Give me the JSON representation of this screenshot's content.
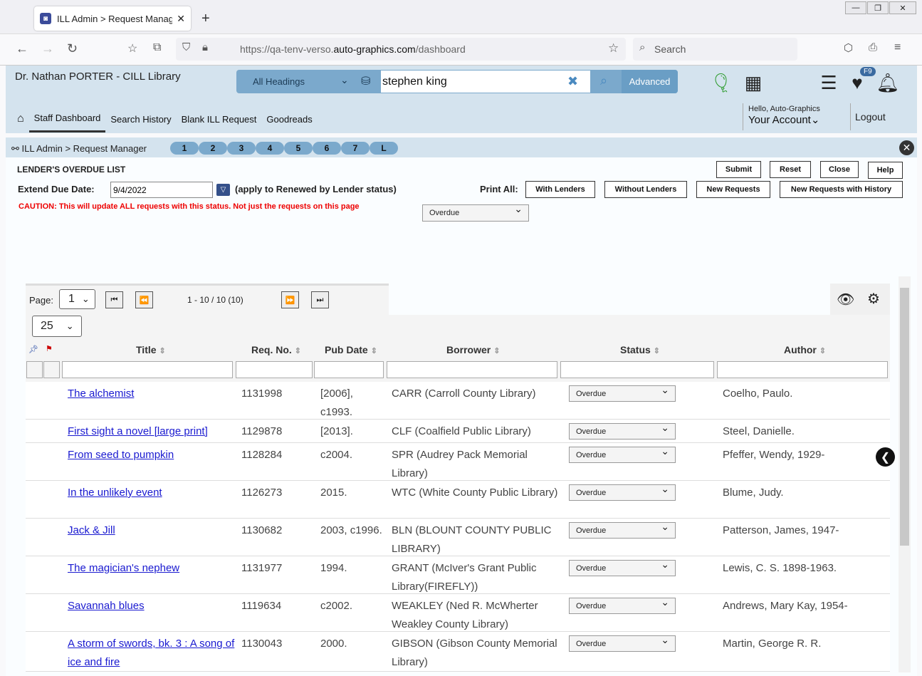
{
  "browser": {
    "tab_title": "ILL Admin > Request Manager |",
    "url_prefix": "https://qa-tenv-verso.",
    "url_host": "auto-graphics.com",
    "url_path": "/dashboard",
    "search_placeholder": "Search",
    "close": "✕",
    "newtab": "+"
  },
  "header": {
    "library": "Dr. Nathan PORTER - CILL Library",
    "scope": "All Headings",
    "query": "stephen king",
    "advanced": "Advanced",
    "badge": "F9"
  },
  "menu": {
    "items": [
      "Staff Dashboard",
      "Search History",
      "Blank ILL Request",
      "Goodreads"
    ],
    "greeting": "Hello, Auto-Graphics",
    "account": "Your Account",
    "logout": "Logout"
  },
  "breadcrumb": {
    "text": "ILL Admin > Request Manager",
    "pages": [
      "1",
      "2",
      "3",
      "4",
      "5",
      "6",
      "7",
      "L"
    ]
  },
  "form": {
    "title": "LENDER'S OVERDUE LIST",
    "submit": "Submit",
    "reset": "Reset",
    "close": "Close",
    "help": "Help",
    "extend_label": "Extend Due Date:",
    "due_date": "9/4/2022",
    "apply_note": "(apply to Renewed by Lender status)",
    "print_all": "Print All:",
    "with_lenders": "With Lenders",
    "without_lenders": "Without Lenders",
    "new_requests": "New Requests",
    "new_requests_history": "New Requests with History",
    "caution": "CAUTION: This will update ALL requests with this status. Not just the requests on this page",
    "status_filter": "Overdue"
  },
  "grid": {
    "page_label": "Page:",
    "page": "1",
    "range": "1 - 10 / 10 (10)",
    "page_size": "25",
    "columns": [
      "Title",
      "Req. No.",
      "Pub Date",
      "Borrower",
      "Status",
      "Author"
    ],
    "rows": [
      {
        "title": "The alchemist",
        "req": "1131998",
        "pub": "[2006], c1993.",
        "borrower": "CARR (Carroll County Library)",
        "status": "Overdue",
        "author": "Coelho, Paulo."
      },
      {
        "title": "First sight a novel [large print]",
        "req": "1129878",
        "pub": "[2013].",
        "borrower": "CLF (Coalfield Public Library)",
        "status": "Overdue",
        "author": "Steel, Danielle."
      },
      {
        "title": "From seed to pumpkin",
        "req": "1128284",
        "pub": "c2004.",
        "borrower": "SPR (Audrey Pack Memorial Library)",
        "status": "Overdue",
        "author": "Pfeffer, Wendy, 1929-"
      },
      {
        "title": "In the unlikely event",
        "req": "1126273",
        "pub": "2015.",
        "borrower": "WTC (White County Public Library)",
        "status": "Overdue",
        "author": "Blume, Judy."
      },
      {
        "title": "Jack & Jill",
        "req": "1130682",
        "pub": "2003, c1996.",
        "borrower": "BLN (BLOUNT COUNTY PUBLIC LIBRARY)",
        "status": "Overdue",
        "author": "Patterson, James, 1947-"
      },
      {
        "title": "The magician's nephew",
        "req": "1131977",
        "pub": "1994.",
        "borrower": "GRANT (McIver's Grant Public Library(FIREFLY))",
        "status": "Overdue",
        "author": "Lewis, C. S. 1898-1963."
      },
      {
        "title": "Savannah blues",
        "req": "1119634",
        "pub": "c2002.",
        "borrower": "WEAKLEY (Ned R. McWherter Weakley County Library)",
        "status": "Overdue",
        "author": "Andrews, Mary Kay, 1954-"
      },
      {
        "title": "A storm of swords, bk. 3 : A song of ice and fire",
        "req": "1130043",
        "pub": "2000.",
        "borrower": "GIBSON (Gibson County Memorial Library)",
        "status": "Overdue",
        "author": "Martin, George R. R."
      }
    ]
  }
}
